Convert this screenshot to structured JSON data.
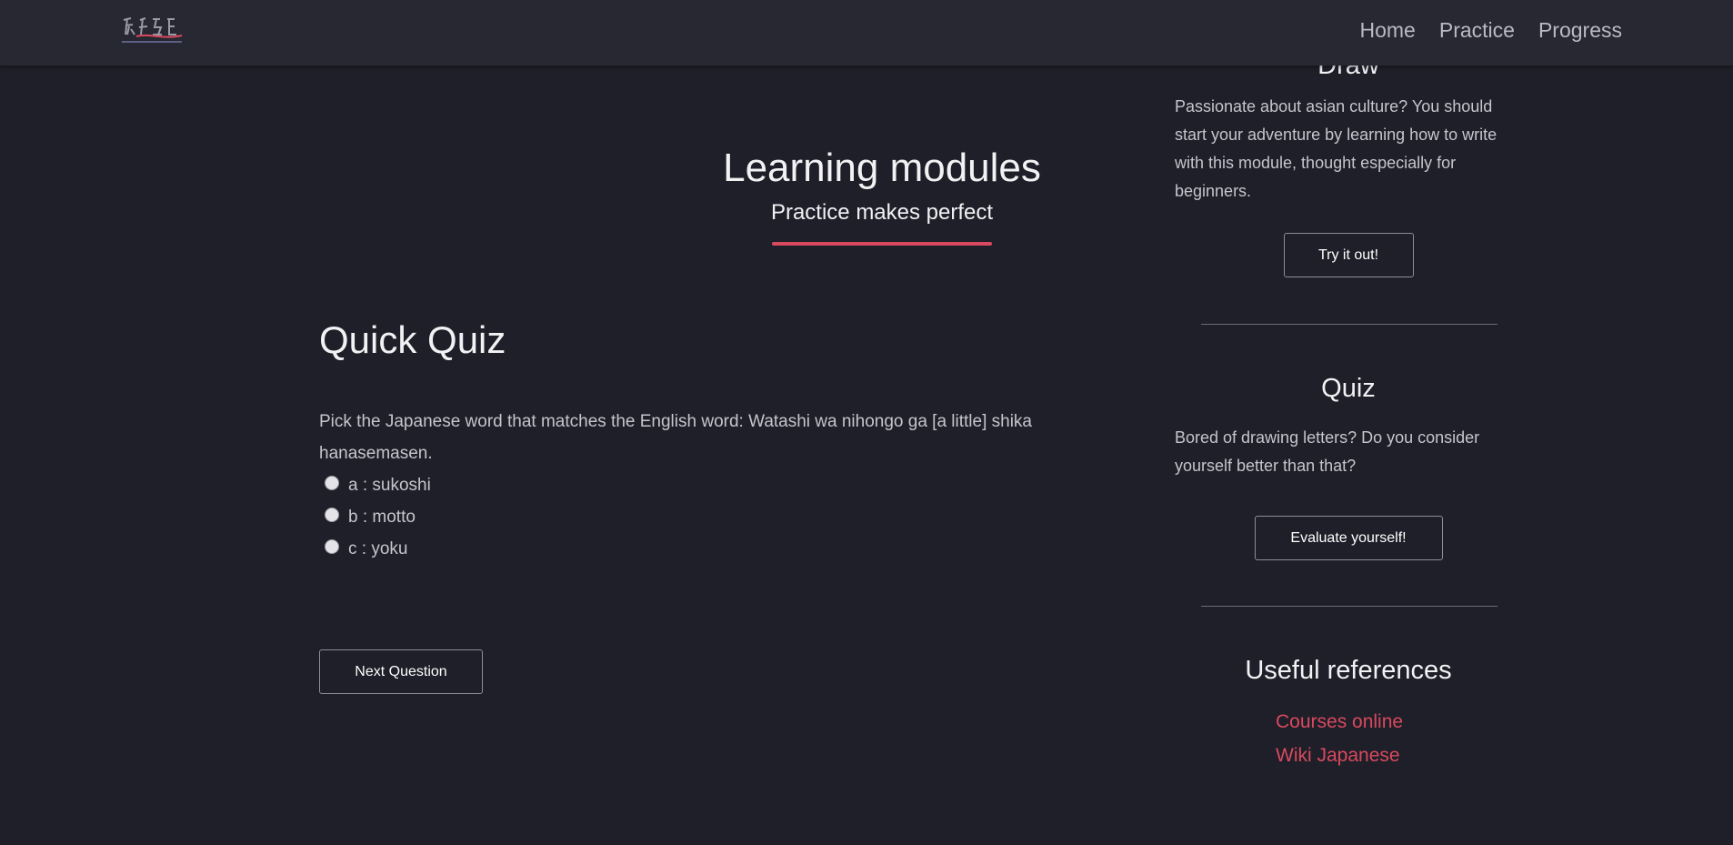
{
  "navbar": {
    "logo_alt": "A.S.L.E.",
    "links": [
      "Home",
      "Practice",
      "Progress"
    ]
  },
  "hero": {
    "title": "Learning modules",
    "subtitle": "Practice makes perfect"
  },
  "quiz": {
    "title": "Quick Quiz",
    "question": "Pick the Japanese word that matches the English word: Watashi wa nihongo ga [a little] shika hanasemasen.",
    "options": [
      "a : sukoshi",
      "b : motto",
      "c : yoku"
    ],
    "next_label": "Next Question"
  },
  "sidebar": {
    "draw": {
      "title": "Draw",
      "text": "Passionate about asian culture? You should start your adventure by learning how to write with this module, thought especially for beginners.",
      "button": "Try it out!"
    },
    "quiz": {
      "title": "Quiz",
      "text": "Bored of drawing letters? Do you consider yourself better than that?",
      "button": "Evaluate yourself!"
    },
    "references": {
      "title": "Useful references",
      "links": [
        "Courses online",
        "Wiki Japanese"
      ]
    }
  },
  "colors": {
    "background": "#1e1f28",
    "navbar": "#272831",
    "accent": "#d9495f"
  }
}
